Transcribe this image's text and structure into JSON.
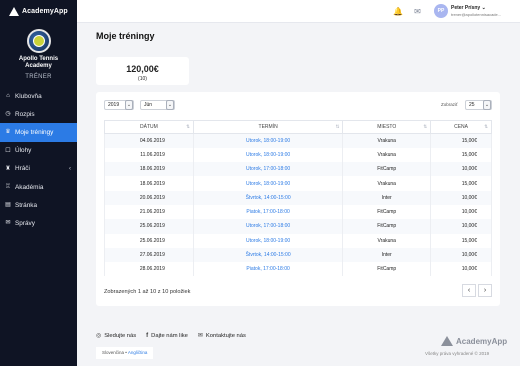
{
  "brand": {
    "name": "AcademyApp"
  },
  "club": {
    "name_line1": "Apollo Tennis",
    "name_line2": "Academy",
    "role": "TRÉNER"
  },
  "nav": [
    {
      "label": "Klubovňa",
      "icon": "home-icon",
      "glyph": "⌂"
    },
    {
      "label": "Rozpis",
      "icon": "clock-icon",
      "glyph": "◷"
    },
    {
      "label": "Moje tréningy",
      "icon": "trophy-icon",
      "glyph": "♛",
      "active": true
    },
    {
      "label": "Úlohy",
      "icon": "tasks-icon",
      "glyph": "☐"
    },
    {
      "label": "Hráči",
      "icon": "players-icon",
      "glyph": "♜",
      "chevron": "‹"
    },
    {
      "label": "Akadémia",
      "icon": "academy-icon",
      "glyph": "♖"
    },
    {
      "label": "Stránka",
      "icon": "page-icon",
      "glyph": "▤"
    },
    {
      "label": "Správy",
      "icon": "messages-icon",
      "glyph": "✉"
    }
  ],
  "topbar": {
    "bell_icon": "🔔",
    "mail_icon": "✉",
    "avatar_initials": "PP",
    "user_name": "Peter Prísny ⌄",
    "user_email": "trener@apollotennisacade..."
  },
  "page": {
    "title": "Moje tréningy"
  },
  "summary": {
    "amount": "120,00€",
    "count": "(10)"
  },
  "filters": {
    "year": "2019",
    "month": "Jún",
    "show_label": "Zobraziť",
    "page_size": "25",
    "arrow": "⌄"
  },
  "table": {
    "headers": [
      "DÁTUM",
      "TERMÍN",
      "MIESTO",
      "CENA"
    ],
    "sort_glyph": "⇅",
    "rows": [
      [
        "04.06.2019",
        "Utorok, 18:00-19:00",
        "Vrakuna",
        "15,00€"
      ],
      [
        "11.06.2019",
        "Utorok, 18:00-19:00",
        "Vrakuna",
        "15,00€"
      ],
      [
        "18.06.2019",
        "Utorok, 17:00-18:00",
        "FitCamp",
        "10,00€"
      ],
      [
        "18.06.2019",
        "Utorok, 18:00-19:00",
        "Vrakuna",
        "15,00€"
      ],
      [
        "20.06.2019",
        "Štvrtok, 14:00-15:00",
        "Inter",
        "10,00€"
      ],
      [
        "21.06.2019",
        "Piatok, 17:00-18:00",
        "FitCamp",
        "10,00€"
      ],
      [
        "25.06.2019",
        "Utorok, 17:00-18:00",
        "FitCamp",
        "10,00€"
      ],
      [
        "25.06.2019",
        "Utorok, 18:00-19:00",
        "Vrakuna",
        "15,00€"
      ],
      [
        "27.06.2019",
        "Štvrtok, 14:00-15:00",
        "Inter",
        "10,00€"
      ],
      [
        "28.06.2019",
        "Piatok, 17:00-18:00",
        "FitCamp",
        "10,00€"
      ]
    ]
  },
  "pagination": {
    "info": "Zobrazených 1 až 10 z 10 položiek",
    "prev": "‹",
    "next": "›"
  },
  "footer": {
    "follow": "Sledujte nás",
    "like": "Dajte nám like",
    "contact": "Kontaktujte nás",
    "follow_icon": "◎",
    "like_icon": "f",
    "contact_icon": "✉",
    "lang_sk": "Slovenčina",
    "lang_sep": " • ",
    "lang_en": "Angličtina",
    "brand": "AcademyApp",
    "copyright": "Všetky práva vyhradené © 2019"
  },
  "colors": {
    "sidebar": "#0f1424",
    "accent": "#2c7be5"
  }
}
